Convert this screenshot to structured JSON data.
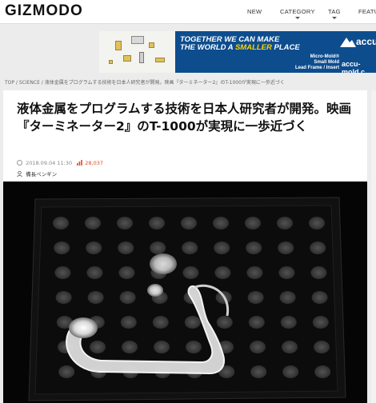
{
  "header": {
    "logo": "GIZMODO",
    "nav": [
      "NEW",
      "CATEGORY",
      "TAG",
      "FEATU"
    ]
  },
  "ad": {
    "headline_line1": "TOGETHER WE CAN MAKE",
    "headline_line2_pre": "THE WORLD A ",
    "headline_line2_em": "SMALLER",
    "headline_line2_post": " PLACE",
    "product_line1": "Micro-Mold®",
    "product_line2": "Small Mold",
    "product_line3": "Lead Frame / Insert",
    "brand": "accu",
    "url": "accu-mold.c"
  },
  "breadcrumb": {
    "top": "TOP",
    "sep": " / ",
    "section": "SCIENCE",
    "current": "液体金属をプログラムする技術を日本人研究者が開発。映画『ターミネーター2』のT-1000が実現に一歩近づく"
  },
  "article": {
    "title": "液体金属をプログラムする技術を日本人研究者が開発。映画『ターミネーター2』のT-1000が実現に一歩近づく",
    "date": "2018.09.04 11:30",
    "views": "28,037",
    "author": "備長ペンギン"
  },
  "colors": {
    "views": "#e24a1b",
    "ad_bg": "#0d4d8e",
    "ad_accent": "#ffd200"
  }
}
